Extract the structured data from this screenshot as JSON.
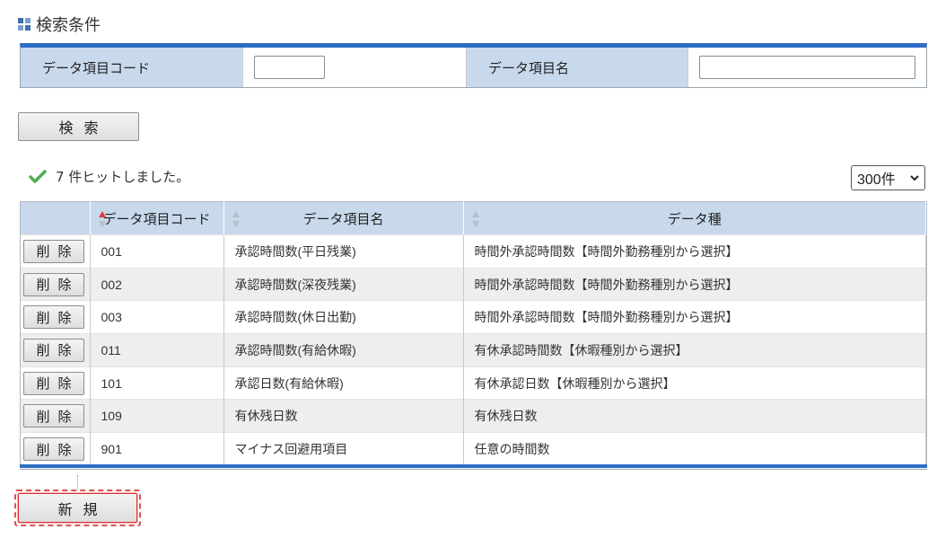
{
  "section_title": "検索条件",
  "search": {
    "code_label": "データ項目コード",
    "code_value": "",
    "name_label": "データ項目名",
    "name_value": "",
    "search_button": "検索"
  },
  "result": {
    "message": "7 件ヒットしました。",
    "page_size": "300件"
  },
  "table": {
    "headers": [
      "",
      "データ項目コード",
      "データ項目名",
      "データ種"
    ],
    "delete_label": "削除",
    "rows": [
      {
        "code": "001",
        "name": "承認時間数(平日残業)",
        "type": "時間外承認時間数【時間外勤務種別から選択】"
      },
      {
        "code": "002",
        "name": "承認時間数(深夜残業)",
        "type": "時間外承認時間数【時間外勤務種別から選択】"
      },
      {
        "code": "003",
        "name": "承認時間数(休日出勤)",
        "type": "時間外承認時間数【時間外勤務種別から選択】"
      },
      {
        "code": "011",
        "name": "承認時間数(有給休暇)",
        "type": "有休承認時間数【休暇種別から選択】"
      },
      {
        "code": "101",
        "name": "承認日数(有給休暇)",
        "type": "有休承認日数【休暇種別から選択】"
      },
      {
        "code": "109",
        "name": "有休残日数",
        "type": "有休残日数"
      },
      {
        "code": "901",
        "name": "マイナス回避用項目",
        "type": "任意の時間数"
      }
    ]
  },
  "new_button": "新規",
  "colors": {
    "accent": "#2b6cc4",
    "header_bg": "#c9d9ec",
    "highlight": "#e05050"
  }
}
